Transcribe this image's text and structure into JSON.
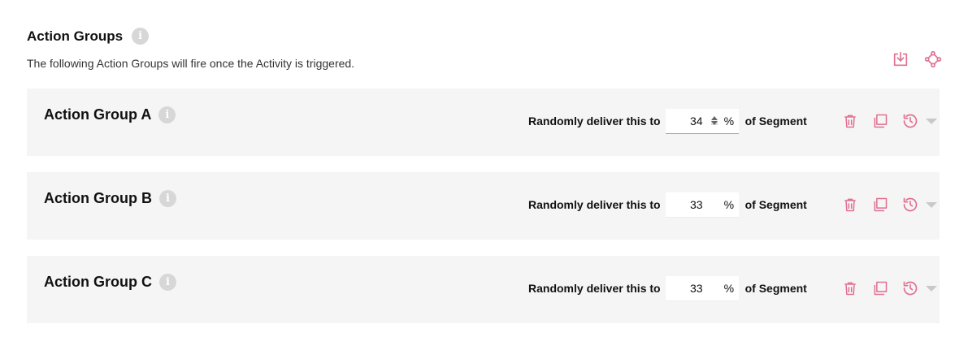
{
  "header": {
    "title": "Action Groups",
    "subtitle": "The following Action Groups will fire once the Activity is triggered.",
    "actions": [
      "download-icon",
      "flow-icon"
    ]
  },
  "groups": [
    {
      "name": "Action Group A",
      "deliver_label": "Randomly deliver this to",
      "percent": "34",
      "percent_sign": "%",
      "segment_label": "of Segment"
    },
    {
      "name": "Action Group B",
      "deliver_label": "Randomly deliver this to",
      "percent": "33",
      "percent_sign": "%",
      "segment_label": "of Segment"
    },
    {
      "name": "Action Group C",
      "deliver_label": "Randomly deliver this to",
      "percent": "33",
      "percent_sign": "%",
      "segment_label": "of Segment"
    }
  ],
  "colors": {
    "accent": "#e0708f",
    "panel": "#f5f5f5",
    "info": "#d7d7d7"
  }
}
